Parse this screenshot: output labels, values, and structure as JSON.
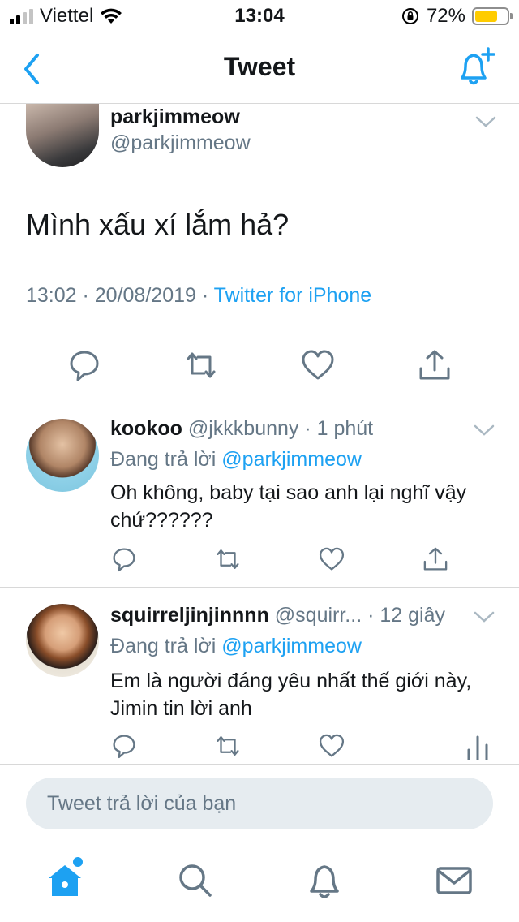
{
  "status_bar": {
    "carrier": "Viettel",
    "time": "13:04",
    "battery": "72%",
    "battery_level": 0.72,
    "icons": [
      "signal-icon",
      "wifi-icon",
      "orientation-lock-icon",
      "battery-icon"
    ]
  },
  "nav": {
    "title": "Tweet",
    "back_icon": "chevron-left-icon",
    "action_icon": "bell-plus-icon"
  },
  "main_tweet": {
    "name": "parkjimmeow",
    "handle": "@parkjimmeow",
    "text": "Mình xấu xí lắm hả?",
    "time": "13:02 · 20/08/2019 ·",
    "source": "Twitter for iPhone",
    "actions": [
      "reply-icon",
      "retweet-icon",
      "like-icon",
      "share-icon"
    ]
  },
  "replies": [
    {
      "name": "kookoo",
      "handle": "@jkkkbunny · 1 phút",
      "replying_label": "Đang trả lời",
      "replying_to": "@parkjimmeow",
      "text": "Oh không, baby tại sao anh lại nghĩ vậy chứ??????",
      "actions": [
        "reply-icon",
        "retweet-icon",
        "like-icon",
        "share-icon"
      ]
    },
    {
      "name": "squirreljinjinnnn",
      "handle": "@squirr... · 12 giây",
      "replying_label": "Đang trả lời",
      "replying_to": "@parkjimmeow",
      "text": "Em là người đáng yêu nhất thế giới này, Jimin tin lời anh",
      "actions": [
        "reply-icon",
        "retweet-icon",
        "like-icon",
        "analytics-icon"
      ]
    }
  ],
  "composer": {
    "placeholder": "Tweet trả lời của bạn"
  },
  "tabbar": {
    "tabs": [
      "home-icon",
      "search-icon",
      "notifications-icon",
      "messages-icon"
    ],
    "accent": "#1da1f2"
  },
  "colors": {
    "accent": "#1da1f2",
    "secondary_text": "#657786",
    "divider": "#d8d8d8"
  }
}
